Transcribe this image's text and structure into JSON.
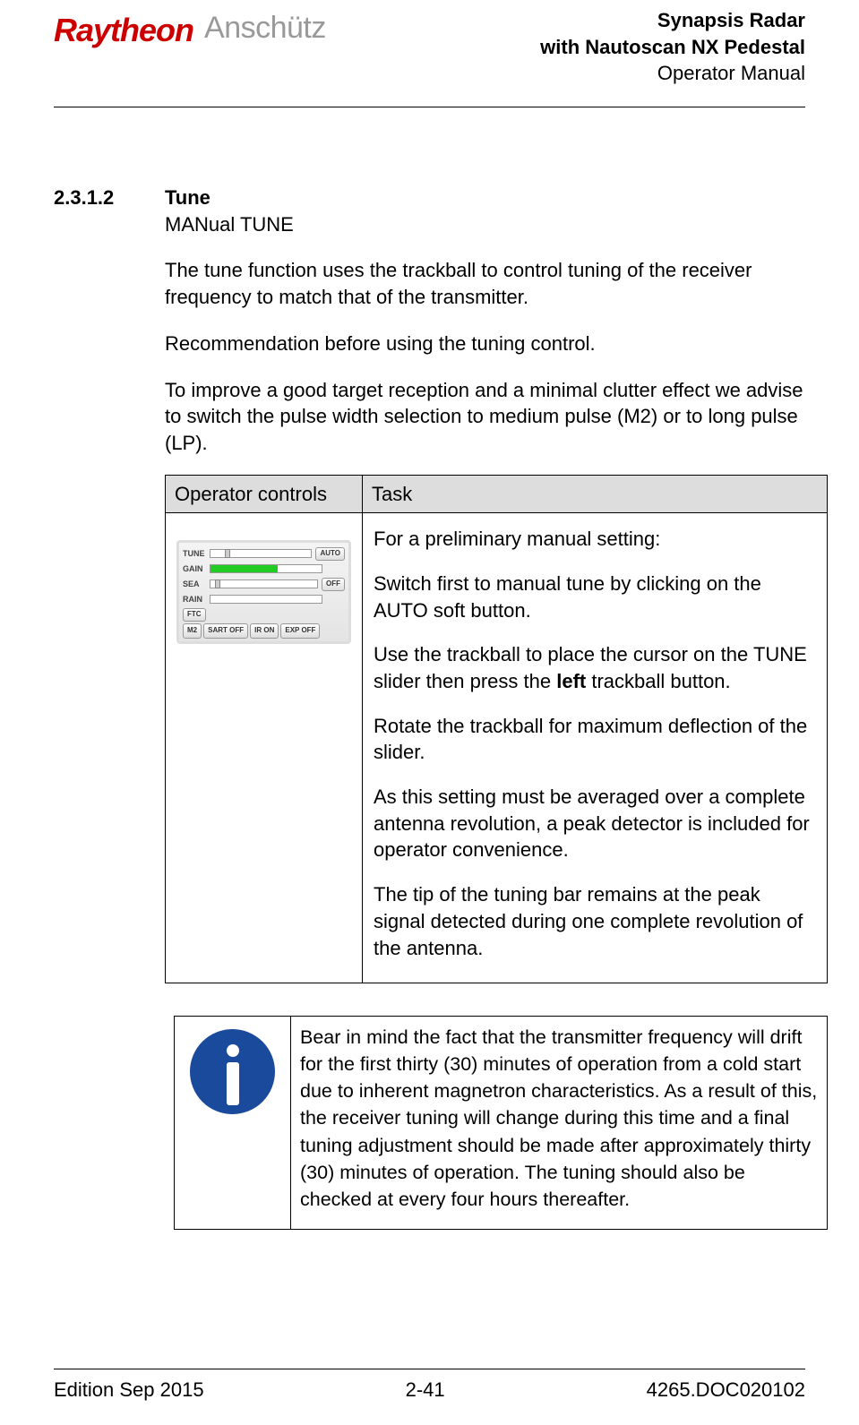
{
  "header": {
    "logo_left": "Raytheon",
    "logo_right": "Anschütz",
    "title_line1": "Synapsis Radar",
    "title_line2": "with Nautoscan NX Pedestal",
    "title_line3": "Operator Manual"
  },
  "section": {
    "number": "2.3.1.2",
    "title": "Tune",
    "subtitle": "MANual TUNE"
  },
  "paragraphs": {
    "p1": "The tune function uses the trackball to control tuning of the receiver frequency to match that of the transmitter.",
    "p2": "Recommendation before using the tuning control.",
    "p3": "To improve a good target reception and a minimal clutter effect we advise to switch the pulse width selection to medium pulse (M2) or to long pulse (LP)."
  },
  "table": {
    "head_col1": "Operator controls",
    "head_col2": "Task",
    "task": {
      "t1": "For a preliminary manual setting:",
      "t2": "Switch first to manual tune by clicking on the AUTO soft button.",
      "t3a": "Use the trackball to place the cursor on the TUNE slider then press the ",
      "t3b": "left",
      "t3c": " trackball button.",
      "t4": "Rotate the trackball for maximum deflection of the slider.",
      "t5": "As this setting must be averaged over a complete antenna revolution, a peak detector is included for operator convenience.",
      "t6": "The tip of the tuning bar remains at the peak signal detected during one complete revolution of the antenna."
    }
  },
  "panel": {
    "tune": "TUNE",
    "gain": "GAIN",
    "sea": "SEA",
    "rain": "RAIN",
    "ftc": "FTC",
    "auto": "AUTO",
    "off": "OFF",
    "m2": "M2",
    "sart": "SART OFF",
    "ir": "IR ON",
    "exp": "EXP OFF"
  },
  "note": {
    "text": "Bear in mind the fact that the transmitter frequency will drift for the first thirty (30) minutes of operation from a cold start due to inherent magnetron characteristics. As a result of this, the receiver tuning will change during this time and a final tuning adjustment should be made after approximately thirty (30) minutes of operation. The tuning should also be checked at every four hours thereafter."
  },
  "footer": {
    "left": "Edition Sep 2015",
    "center": "2-41",
    "right": "4265.DOC020102"
  }
}
